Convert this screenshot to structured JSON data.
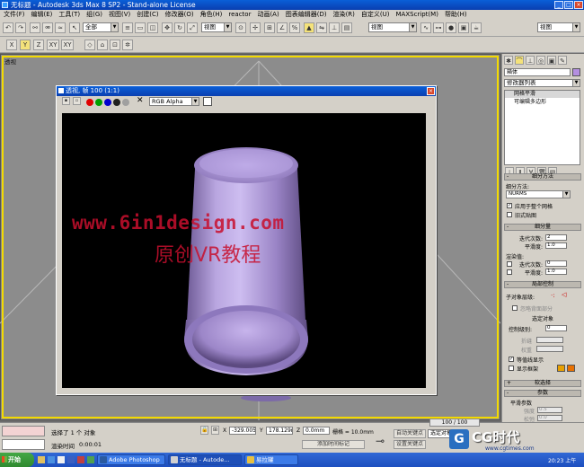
{
  "window": {
    "title": "无标题 - Autodesk 3ds Max 8 SP2  - Stand-alone License"
  },
  "menu": [
    "文件(F)",
    "编辑(E)",
    "工具(T)",
    "组(G)",
    "视图(V)",
    "创建(C)",
    "修改器(O)",
    "角色(H)",
    "reactor",
    "动画(A)",
    "图表编辑器(D)",
    "渲染(R)",
    "自定义(U)",
    "MAXScript(M)",
    "帮助(H)"
  ],
  "toolbar": {
    "selection_filter": "全部",
    "ref_coord": "视图",
    "named_selection": "视图",
    "axis_x": "X",
    "axis_y": "Y",
    "axis_z": "Z",
    "axis_xy": "XY",
    "axis_xy2": "XY"
  },
  "viewport": {
    "label": "透视"
  },
  "render_frame": {
    "title": "透视, 帧 100 (1:1)",
    "channel": "RGB Alpha",
    "watermark_url": "www.6in1design.com",
    "watermark_cn": "原创VR教程"
  },
  "command_panel": {
    "object_name": "箱体",
    "modifier_list": "修改器列表",
    "stack": [
      "网格平滑",
      "可编辑多边形"
    ],
    "rollout_subdiv_method": "细分方法",
    "subdiv_method_label": "细分方法:",
    "subdiv_method_value": "NURMS",
    "apply_whole_mesh": "应用于整个网格",
    "old_style_mapping": "旧式贴图",
    "rollout_subdiv_amount": "细分量",
    "iterations_label": "迭代次数:",
    "iterations_value": "2",
    "smoothness_label": "平滑度:",
    "smoothness_value": "1.0",
    "render_label": "渲染值:",
    "render_iterations_label": "迭代次数:",
    "render_iterations_value": "0",
    "render_smoothness_label": "平滑度:",
    "render_smoothness_value": "1.0",
    "rollout_local_control": "局部控制",
    "sublevel_label": "子对象层级:",
    "ignore_backface": "忽略背面部分",
    "select_object": "选定对象",
    "control_level_label": "控制级别:",
    "control_level_value": "0",
    "crease_label": "折缝",
    "weight_label": "权重",
    "show_cage": "显示框架",
    "isoline_display": "等值线显示",
    "rollout_soft_select": "软选择",
    "rollout_params": "参数",
    "smooth_params": "平滑参数",
    "strength_label": "强度",
    "strength_value": "0.5",
    "relax_label": "松弛",
    "relax_value": "0.0"
  },
  "status": {
    "selected": "选择了 1 个 对象",
    "render_time_label": "渲染时间",
    "render_time": "0:00:01",
    "x_label": "X",
    "x_value": "-329.005m",
    "y_label": "Y",
    "y_value": "178.129m",
    "z_label": "Z",
    "z_value": "0.0mm",
    "grid": "栅格 = 10.0mm",
    "auto_key": "自动关键点",
    "set_key": "设置关键点",
    "add_time_tag": "添加时间标记",
    "key_filter": "选定对象",
    "time_slider": "100 / 100"
  },
  "taskbar": {
    "start": "开始",
    "tasks": [
      "Adobe Photoshop",
      "无标题 - Autode...",
      "易拉罐"
    ],
    "clock": "20:23 上午"
  },
  "watermark_logo": "CG时代",
  "watermark_site": "www.cgtimes.com",
  "colors": {
    "title_blue": "#0a4fc8",
    "viewport_border": "#f3d900",
    "can_color": "#a88fd0",
    "watermark_red": "#c8102e"
  }
}
